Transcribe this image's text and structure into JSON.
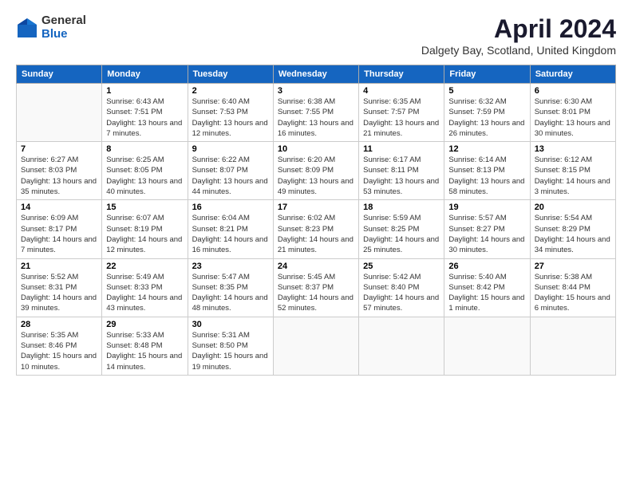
{
  "logo": {
    "general": "General",
    "blue": "Blue"
  },
  "header": {
    "title": "April 2024",
    "subtitle": "Dalgety Bay, Scotland, United Kingdom"
  },
  "columns": [
    "Sunday",
    "Monday",
    "Tuesday",
    "Wednesday",
    "Thursday",
    "Friday",
    "Saturday"
  ],
  "weeks": [
    [
      {
        "num": "",
        "sunrise": "",
        "sunset": "",
        "daylight": ""
      },
      {
        "num": "1",
        "sunrise": "Sunrise: 6:43 AM",
        "sunset": "Sunset: 7:51 PM",
        "daylight": "Daylight: 13 hours and 7 minutes."
      },
      {
        "num": "2",
        "sunrise": "Sunrise: 6:40 AM",
        "sunset": "Sunset: 7:53 PM",
        "daylight": "Daylight: 13 hours and 12 minutes."
      },
      {
        "num": "3",
        "sunrise": "Sunrise: 6:38 AM",
        "sunset": "Sunset: 7:55 PM",
        "daylight": "Daylight: 13 hours and 16 minutes."
      },
      {
        "num": "4",
        "sunrise": "Sunrise: 6:35 AM",
        "sunset": "Sunset: 7:57 PM",
        "daylight": "Daylight: 13 hours and 21 minutes."
      },
      {
        "num": "5",
        "sunrise": "Sunrise: 6:32 AM",
        "sunset": "Sunset: 7:59 PM",
        "daylight": "Daylight: 13 hours and 26 minutes."
      },
      {
        "num": "6",
        "sunrise": "Sunrise: 6:30 AM",
        "sunset": "Sunset: 8:01 PM",
        "daylight": "Daylight: 13 hours and 30 minutes."
      }
    ],
    [
      {
        "num": "7",
        "sunrise": "Sunrise: 6:27 AM",
        "sunset": "Sunset: 8:03 PM",
        "daylight": "Daylight: 13 hours and 35 minutes."
      },
      {
        "num": "8",
        "sunrise": "Sunrise: 6:25 AM",
        "sunset": "Sunset: 8:05 PM",
        "daylight": "Daylight: 13 hours and 40 minutes."
      },
      {
        "num": "9",
        "sunrise": "Sunrise: 6:22 AM",
        "sunset": "Sunset: 8:07 PM",
        "daylight": "Daylight: 13 hours and 44 minutes."
      },
      {
        "num": "10",
        "sunrise": "Sunrise: 6:20 AM",
        "sunset": "Sunset: 8:09 PM",
        "daylight": "Daylight: 13 hours and 49 minutes."
      },
      {
        "num": "11",
        "sunrise": "Sunrise: 6:17 AM",
        "sunset": "Sunset: 8:11 PM",
        "daylight": "Daylight: 13 hours and 53 minutes."
      },
      {
        "num": "12",
        "sunrise": "Sunrise: 6:14 AM",
        "sunset": "Sunset: 8:13 PM",
        "daylight": "Daylight: 13 hours and 58 minutes."
      },
      {
        "num": "13",
        "sunrise": "Sunrise: 6:12 AM",
        "sunset": "Sunset: 8:15 PM",
        "daylight": "Daylight: 14 hours and 3 minutes."
      }
    ],
    [
      {
        "num": "14",
        "sunrise": "Sunrise: 6:09 AM",
        "sunset": "Sunset: 8:17 PM",
        "daylight": "Daylight: 14 hours and 7 minutes."
      },
      {
        "num": "15",
        "sunrise": "Sunrise: 6:07 AM",
        "sunset": "Sunset: 8:19 PM",
        "daylight": "Daylight: 14 hours and 12 minutes."
      },
      {
        "num": "16",
        "sunrise": "Sunrise: 6:04 AM",
        "sunset": "Sunset: 8:21 PM",
        "daylight": "Daylight: 14 hours and 16 minutes."
      },
      {
        "num": "17",
        "sunrise": "Sunrise: 6:02 AM",
        "sunset": "Sunset: 8:23 PM",
        "daylight": "Daylight: 14 hours and 21 minutes."
      },
      {
        "num": "18",
        "sunrise": "Sunrise: 5:59 AM",
        "sunset": "Sunset: 8:25 PM",
        "daylight": "Daylight: 14 hours and 25 minutes."
      },
      {
        "num": "19",
        "sunrise": "Sunrise: 5:57 AM",
        "sunset": "Sunset: 8:27 PM",
        "daylight": "Daylight: 14 hours and 30 minutes."
      },
      {
        "num": "20",
        "sunrise": "Sunrise: 5:54 AM",
        "sunset": "Sunset: 8:29 PM",
        "daylight": "Daylight: 14 hours and 34 minutes."
      }
    ],
    [
      {
        "num": "21",
        "sunrise": "Sunrise: 5:52 AM",
        "sunset": "Sunset: 8:31 PM",
        "daylight": "Daylight: 14 hours and 39 minutes."
      },
      {
        "num": "22",
        "sunrise": "Sunrise: 5:49 AM",
        "sunset": "Sunset: 8:33 PM",
        "daylight": "Daylight: 14 hours and 43 minutes."
      },
      {
        "num": "23",
        "sunrise": "Sunrise: 5:47 AM",
        "sunset": "Sunset: 8:35 PM",
        "daylight": "Daylight: 14 hours and 48 minutes."
      },
      {
        "num": "24",
        "sunrise": "Sunrise: 5:45 AM",
        "sunset": "Sunset: 8:37 PM",
        "daylight": "Daylight: 14 hours and 52 minutes."
      },
      {
        "num": "25",
        "sunrise": "Sunrise: 5:42 AM",
        "sunset": "Sunset: 8:40 PM",
        "daylight": "Daylight: 14 hours and 57 minutes."
      },
      {
        "num": "26",
        "sunrise": "Sunrise: 5:40 AM",
        "sunset": "Sunset: 8:42 PM",
        "daylight": "Daylight: 15 hours and 1 minute."
      },
      {
        "num": "27",
        "sunrise": "Sunrise: 5:38 AM",
        "sunset": "Sunset: 8:44 PM",
        "daylight": "Daylight: 15 hours and 6 minutes."
      }
    ],
    [
      {
        "num": "28",
        "sunrise": "Sunrise: 5:35 AM",
        "sunset": "Sunset: 8:46 PM",
        "daylight": "Daylight: 15 hours and 10 minutes."
      },
      {
        "num": "29",
        "sunrise": "Sunrise: 5:33 AM",
        "sunset": "Sunset: 8:48 PM",
        "daylight": "Daylight: 15 hours and 14 minutes."
      },
      {
        "num": "30",
        "sunrise": "Sunrise: 5:31 AM",
        "sunset": "Sunset: 8:50 PM",
        "daylight": "Daylight: 15 hours and 19 minutes."
      },
      {
        "num": "",
        "sunrise": "",
        "sunset": "",
        "daylight": ""
      },
      {
        "num": "",
        "sunrise": "",
        "sunset": "",
        "daylight": ""
      },
      {
        "num": "",
        "sunrise": "",
        "sunset": "",
        "daylight": ""
      },
      {
        "num": "",
        "sunrise": "",
        "sunset": "",
        "daylight": ""
      }
    ]
  ]
}
